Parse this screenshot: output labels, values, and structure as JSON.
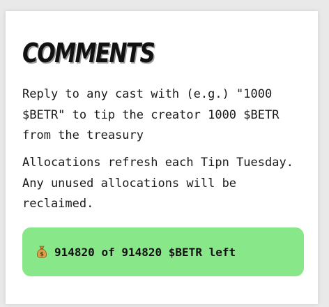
{
  "card": {
    "title": "COMMENTS",
    "paragraph_1": "Reply to any cast with (e.g.) \"1000 $BETR\" to tip the creator 1000 $BETR from the treasury",
    "paragraph_2": "Allocations refresh each Tipn Tuesday. Any unused allocations will be reclaimed."
  },
  "allocation": {
    "icon": "money-bag-icon",
    "remaining": "914820",
    "of_word": "of",
    "total": "914820",
    "token": "$BETR",
    "suffix": "left",
    "background_color": "#88e788"
  }
}
